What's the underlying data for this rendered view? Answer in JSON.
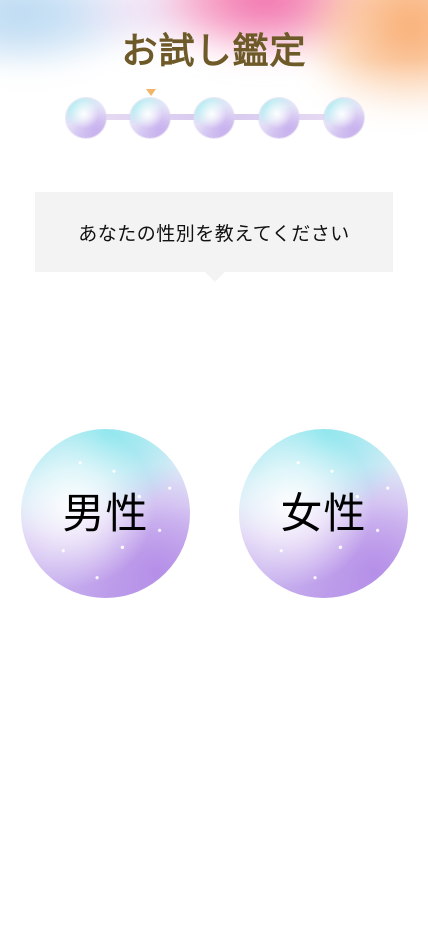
{
  "header": {
    "title": "お試し鑑定"
  },
  "steps": {
    "count": 5,
    "current": 2,
    "marker_color": "#f2b46a"
  },
  "question": {
    "text": "あなたの性別を教えてください"
  },
  "options": {
    "male_label": "男性",
    "female_label": "女性"
  },
  "colors": {
    "title": "#6e5a28",
    "question_bg": "#f3f3f3",
    "header_pink": "#f06aa8",
    "header_orange": "#f9a86b",
    "header_blue": "#b6d7f0"
  }
}
